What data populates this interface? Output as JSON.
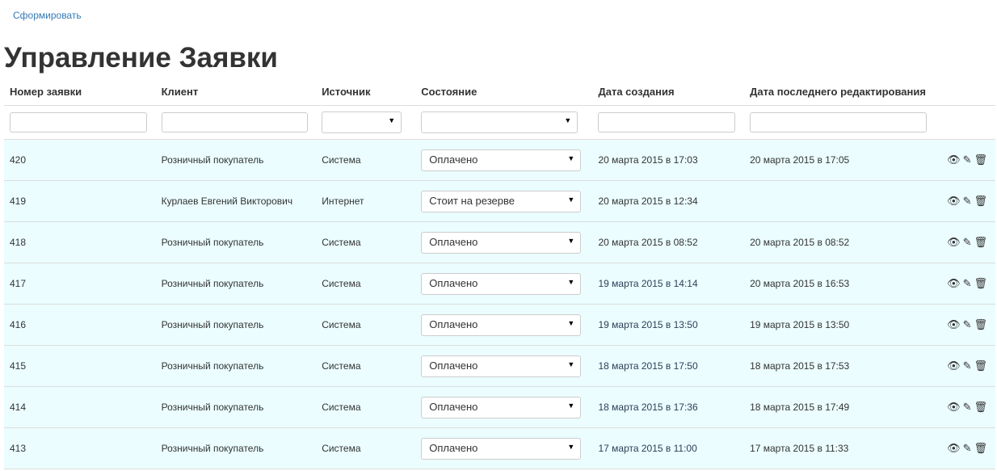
{
  "top_link": "Сформировать",
  "title": "Управление Заявки",
  "columns": [
    "Номер заявки",
    "Клиент",
    "Источник",
    "Состояние",
    "Дата создания",
    "Дата последнего редактирования"
  ],
  "rows": [
    {
      "id": "420",
      "client": "Розничный покупатель",
      "source": "Система",
      "status": "Оплачено",
      "created": "20 марта 2015 в 17:03",
      "edited": "20 марта 2015 в 17:05"
    },
    {
      "id": "419",
      "client": "Курлаев Евгений Викторович",
      "source": "Интернет",
      "status": "Стоит на резерве",
      "created": "20 марта 2015 в 12:34",
      "edited": ""
    },
    {
      "id": "418",
      "client": "Розничный покупатель",
      "source": "Система",
      "status": "Оплачено",
      "created": "20 марта 2015 в 08:52",
      "edited": "20 марта 2015 в 08:52"
    },
    {
      "id": "417",
      "client": "Розничный покупатель",
      "source": "Система",
      "status": "Оплачено",
      "created": "19 марта 2015 в 14:14",
      "edited": "20 марта 2015 в 16:53"
    },
    {
      "id": "416",
      "client": "Розничный покупатель",
      "source": "Система",
      "status": "Оплачено",
      "created": "19 марта 2015 в 13:50",
      "edited": "19 марта 2015 в 13:50"
    },
    {
      "id": "415",
      "client": "Розничный покупатель",
      "source": "Система",
      "status": "Оплачено",
      "created": "18 марта 2015 в 17:50",
      "edited": "18 марта 2015 в 17:53"
    },
    {
      "id": "414",
      "client": "Розничный покупатель",
      "source": "Система",
      "status": "Оплачено",
      "created": "18 марта 2015 в 17:36",
      "edited": "18 марта 2015 в 17:49"
    },
    {
      "id": "413",
      "client": "Розничный покупатель",
      "source": "Система",
      "status": "Оплачено",
      "created": "17 марта 2015 в 11:00",
      "edited": "17 марта 2015 в 11:33"
    }
  ]
}
